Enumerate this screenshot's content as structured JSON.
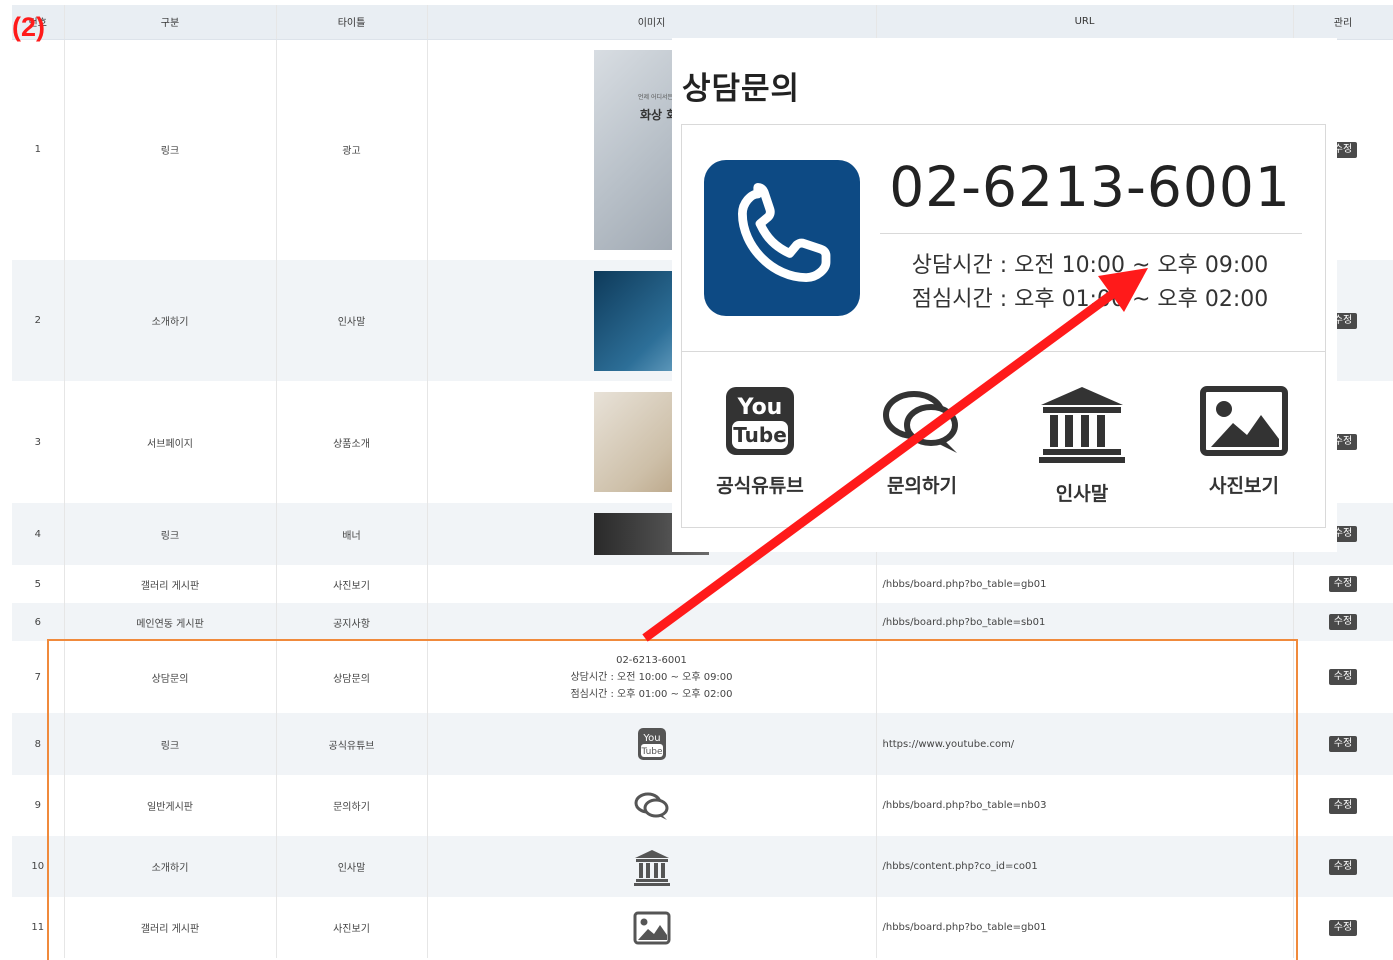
{
  "annotation": {
    "label": "(2)"
  },
  "columns": [
    "번호",
    "구분",
    "타이틀",
    "이미지",
    "URL",
    "관리"
  ],
  "edit_label": "수정",
  "rows": [
    {
      "no": "1",
      "category": "링크",
      "title": "광고",
      "url": ""
    },
    {
      "no": "2",
      "category": "소개하기",
      "title": "인사말",
      "url": ""
    },
    {
      "no": "3",
      "category": "서브페이지",
      "title": "상품소개",
      "url": ""
    },
    {
      "no": "4",
      "category": "링크",
      "title": "배너",
      "url": ""
    },
    {
      "no": "5",
      "category": "갤러리 게시판",
      "title": "사진보기",
      "url": "/hbbs/board.php?bo_table=gb01"
    },
    {
      "no": "6",
      "category": "메인연동 게시판",
      "title": "공지사항",
      "url": "/hbbs/board.php?bo_table=sb01"
    },
    {
      "no": "7",
      "category": "상담문의",
      "title": "상담문의",
      "url": ""
    },
    {
      "no": "8",
      "category": "링크",
      "title": "공식유튜브",
      "url": "https://www.youtube.com/"
    },
    {
      "no": "9",
      "category": "일반게시판",
      "title": "문의하기",
      "url": "/hbbs/board.php?bo_table=nb03"
    },
    {
      "no": "10",
      "category": "소개하기",
      "title": "인사말",
      "url": "/hbbs/content.php?co_id=co01"
    },
    {
      "no": "11",
      "category": "갤러리 게시판",
      "title": "사진보기",
      "url": "/hbbs/board.php?bo_table=gb01"
    }
  ],
  "thumb1": {
    "caption": "화상 회의 시",
    "small": "언제 어디서든 편리하게 소"
  },
  "contact_cell": {
    "phone": "02-6213-6001",
    "hours": "상담시간 : 오전 10:00 ~ 오후 09:00",
    "lunch": "점심시간 : 오후 01:00 ~ 오후 02:00"
  },
  "popup": {
    "title": "상담문의",
    "phone": "02-6213-6001",
    "hours": "상담시간 : 오전 10:00 ~ 오후 09:00",
    "lunch": "점심시간 : 오후 01:00 ~ 오후 02:00",
    "links": [
      "공식유튜브",
      "문의하기",
      "인사말",
      "사진보기"
    ]
  },
  "colors": {
    "phone_box": "#0d4a84",
    "arrow": "#ff1a1a",
    "highlight": "#f08a3c",
    "header_bg": "#e9eef3",
    "alt_row": "#f1f4f7"
  }
}
